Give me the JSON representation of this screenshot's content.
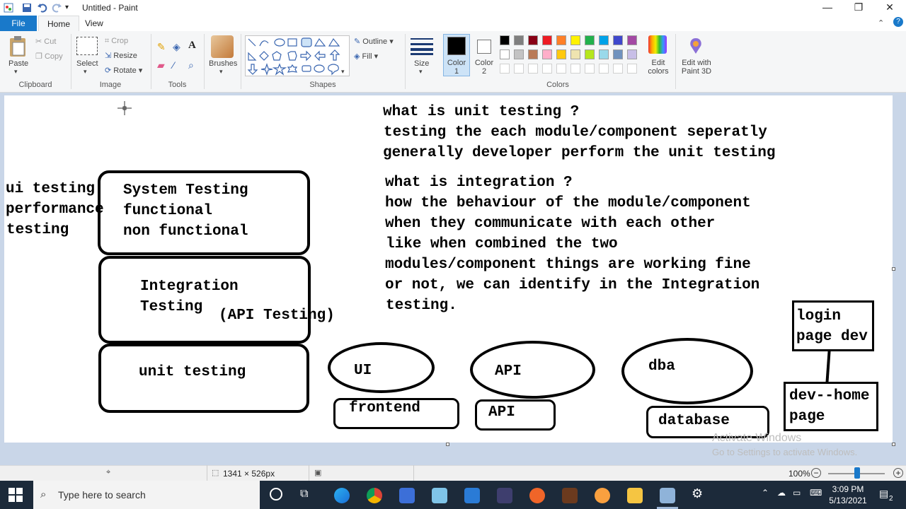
{
  "window": {
    "title": "Untitled - Paint",
    "minimize_glyph": "—",
    "restore_glyph": "❐",
    "close_glyph": "✕"
  },
  "tabs": {
    "file": "File",
    "home": "Home",
    "view": "View"
  },
  "ribbon": {
    "clipboard": {
      "paste": "Paste",
      "cut": "Cut",
      "copy": "Copy",
      "label": "Clipboard"
    },
    "image": {
      "select": "Select",
      "crop": "Crop",
      "resize": "Resize",
      "rotate": "Rotate",
      "label": "Image"
    },
    "tools": {
      "label": "Tools"
    },
    "brushes": {
      "label": "Brushes"
    },
    "shapes": {
      "outline": "Outline",
      "fill": "Fill",
      "label": "Shapes"
    },
    "size": {
      "label": "Size"
    },
    "color1": {
      "line1": "Color",
      "line2": "1"
    },
    "color2": {
      "line1": "Color",
      "line2": "2"
    },
    "colors": {
      "label": "Colors",
      "edit_line1": "Edit",
      "edit_line2": "colors",
      "paint3d_line1": "Edit with",
      "paint3d_line2": "Paint 3D",
      "row1": [
        "#000000",
        "#7f7f7f",
        "#880015",
        "#ed1c24",
        "#ff7f27",
        "#fff200",
        "#22b14c",
        "#00a2e8",
        "#3f48cc",
        "#a349a4"
      ],
      "row2": [
        "#ffffff",
        "#c3c3c3",
        "#b97a57",
        "#ffaec9",
        "#ffc90e",
        "#efe4b0",
        "#b5e61d",
        "#99d9ea",
        "#7092be",
        "#c8bfe7"
      ],
      "primary": "#000000",
      "secondary": "#ffffff"
    }
  },
  "canvas": {
    "notes": {
      "unit_q": "what is unit testing ?",
      "unit_a1": "testing the each module/component seperatly",
      "unit_a2": "generally developer perform the unit testing",
      "int_q": "what is integration ?",
      "int_a1": "how the behaviour of the module/component",
      "int_a2": "when they communicate with each other",
      "int_a3": "like when combined the two",
      "int_a4": "modules/component things are working fine",
      "int_a5": "or not, we can identify in the Integration",
      "int_a6": "testing."
    },
    "side": {
      "l1": "ui testing",
      "l2": "performance",
      "l3": "testing"
    },
    "pyramid": {
      "system_title": "System Testing",
      "system_l2": "functional",
      "system_l3": "non functional",
      "integration_l1": "Integration",
      "integration_l2": "Testing",
      "api_testing": "(API Testing)",
      "unit": "unit testing"
    },
    "components": {
      "ui": "UI",
      "frontend": "frontend",
      "api": "API",
      "api_box": "API",
      "dba": "dba",
      "database": "database",
      "login_l1": "login",
      "login_l2": "page dev",
      "home_l1": "dev--home",
      "home_l2": "page"
    }
  },
  "status": {
    "dimensions": "1341 × 526px",
    "zoom": "100%"
  },
  "watermark": {
    "line1": "Activate Windows",
    "line2": "Go to Settings to activate Windows."
  },
  "taskbar": {
    "search_placeholder": "Type here to search",
    "time": "3:09 PM",
    "date": "5/13/2021",
    "notif_count": "2"
  }
}
